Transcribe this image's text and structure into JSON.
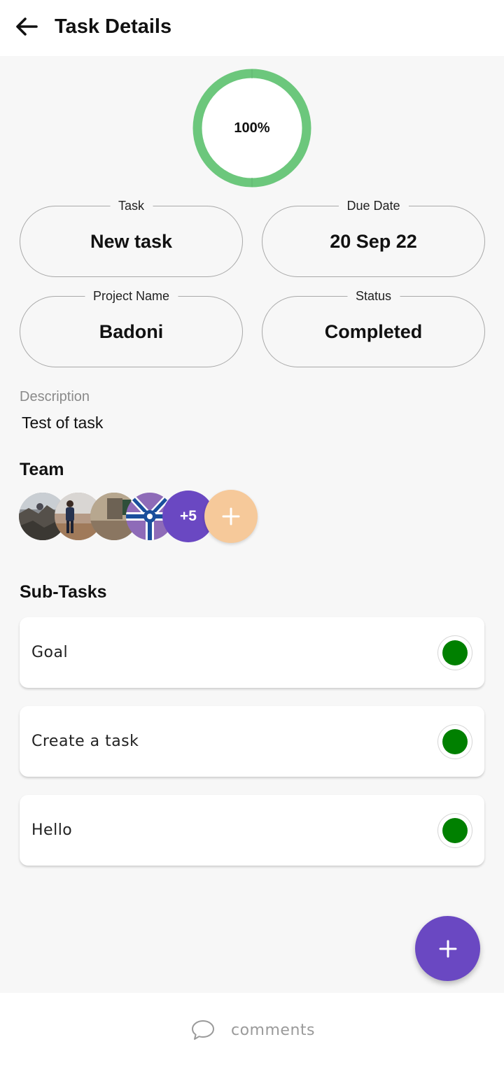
{
  "header": {
    "title": "Task Details"
  },
  "progress": {
    "value": 100,
    "label": "100%",
    "color": "#6cc77c"
  },
  "fields": {
    "task": {
      "legend": "Task",
      "value": "New task"
    },
    "due_date": {
      "legend": "Due Date",
      "value": "20 Sep 22"
    },
    "project": {
      "legend": "Project Name",
      "value": "Badoni"
    },
    "status": {
      "legend": "Status",
      "value": "Completed"
    }
  },
  "description": {
    "label": "Description",
    "value": "Test of task"
  },
  "team": {
    "title": "Team",
    "more_label": "+5",
    "add_label": "+",
    "colors": {
      "more": "#6a48c2",
      "add": "#f6c99a"
    }
  },
  "subtasks": {
    "title": "Sub-Tasks",
    "items": [
      {
        "label": "Goal",
        "status_color": "#008000"
      },
      {
        "label": "Create a task",
        "status_color": "#008000"
      },
      {
        "label": "Hello",
        "status_color": "#008000"
      }
    ]
  },
  "fab": {
    "label": "+"
  },
  "footer": {
    "comments_label": "comments"
  }
}
